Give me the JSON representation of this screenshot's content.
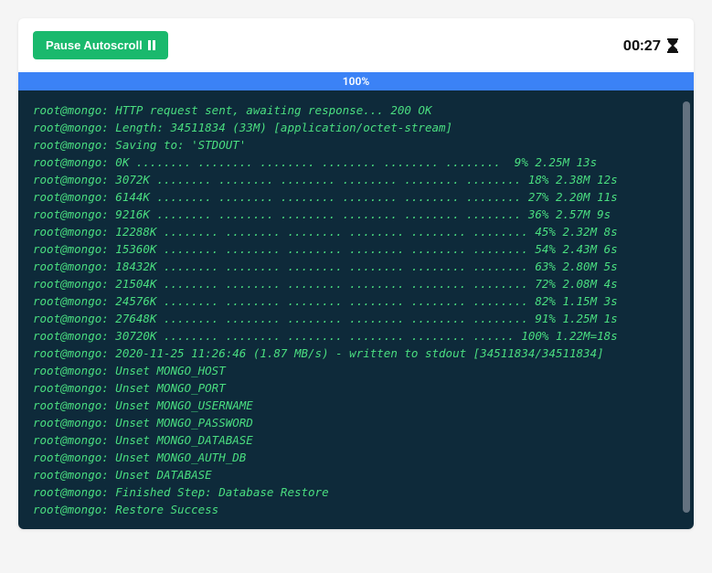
{
  "header": {
    "pause_label": "Pause Autoscroll",
    "timer": "00:27"
  },
  "progress": {
    "percent": "100%"
  },
  "terminal": {
    "prefix": "root@mongo:",
    "lines": [
      "HTTP request sent, awaiting response... 200 OK",
      "Length: 34511834 (33M) [application/octet-stream]",
      "Saving to: 'STDOUT'",
      "0K ........ ........ ........ ........ ........ ........  9% 2.25M 13s",
      "3072K ........ ........ ........ ........ ........ ........ 18% 2.38M 12s",
      "6144K ........ ........ ........ ........ ........ ........ 27% 2.20M 11s",
      "9216K ........ ........ ........ ........ ........ ........ 36% 2.57M 9s",
      "12288K ........ ........ ........ ........ ........ ........ 45% 2.32M 8s",
      "15360K ........ ........ ........ ........ ........ ........ 54% 2.43M 6s",
      "18432K ........ ........ ........ ........ ........ ........ 63% 2.80M 5s",
      "21504K ........ ........ ........ ........ ........ ........ 72% 2.08M 4s",
      "24576K ........ ........ ........ ........ ........ ........ 82% 1.15M 3s",
      "27648K ........ ........ ........ ........ ........ ........ 91% 1.25M 1s",
      "30720K ........ ........ ........ ........ ........ ...... 100% 1.22M=18s",
      "2020-11-25 11:26:46 (1.87 MB/s) - written to stdout [34511834/34511834]",
      "Unset MONGO_HOST",
      "Unset MONGO_PORT",
      "Unset MONGO_USERNAME",
      "Unset MONGO_PASSWORD",
      "Unset MONGO_DATABASE",
      "Unset MONGO_AUTH_DB",
      "Unset DATABASE",
      "Finished Step: Database Restore",
      "Restore Success"
    ]
  }
}
